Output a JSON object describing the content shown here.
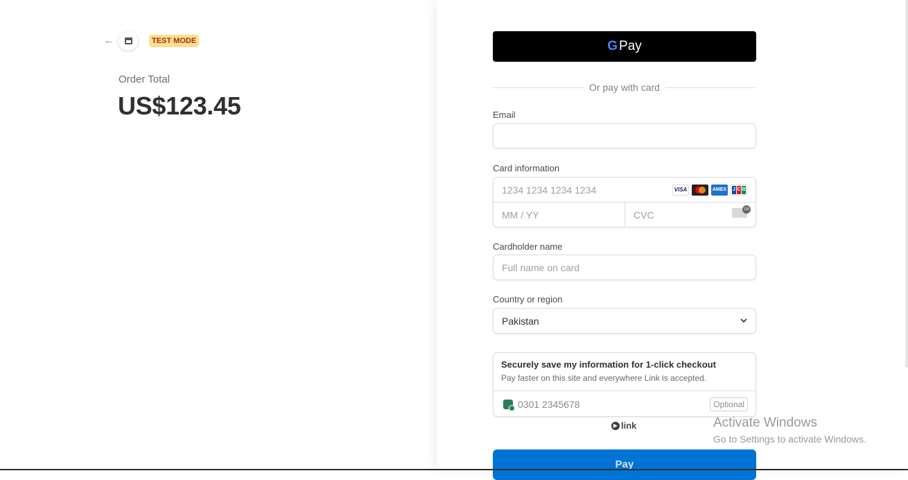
{
  "header": {
    "back_icon": "arrow-left-icon",
    "store_icon": "store-icon",
    "test_mode_badge": "TEST MODE"
  },
  "order": {
    "label": "Order Total",
    "amount": "US$123.45"
  },
  "gpay": {
    "g_letter": "G",
    "label": "Pay"
  },
  "divider_text": "Or pay with card",
  "email": {
    "label": "Email",
    "value": "",
    "placeholder": ""
  },
  "card": {
    "label": "Card information",
    "number_placeholder": "1234 1234 1234 1234",
    "expiry_placeholder": "MM / YY",
    "cvc_placeholder": "CVC",
    "brands": [
      "VISA",
      "Mastercard",
      "AMEX",
      "JCB"
    ],
    "visa_text": "VISA",
    "amex_text": "AMEX",
    "jcb_letters": [
      "J",
      "C",
      "B"
    ]
  },
  "cardholder": {
    "label": "Cardholder name",
    "placeholder": "Full name on card"
  },
  "country": {
    "label": "Country or region",
    "selected": "Pakistan"
  },
  "link_save": {
    "title": "Securely save my information for 1-click checkout",
    "subtitle": "Pay faster on this site and everywhere Link is accepted.",
    "phone_placeholder": "0301 2345678",
    "optional_badge": "Optional"
  },
  "link_logo": {
    "text": "link"
  },
  "pay_button": "Pay",
  "watermark": {
    "line1": "Activate Windows",
    "line2": "Go to Settings to activate Windows."
  },
  "colors": {
    "pay_button": "#0074d4",
    "gpay_button": "#000000",
    "test_badge_bg": "#ffde92",
    "test_badge_text": "#983705"
  }
}
